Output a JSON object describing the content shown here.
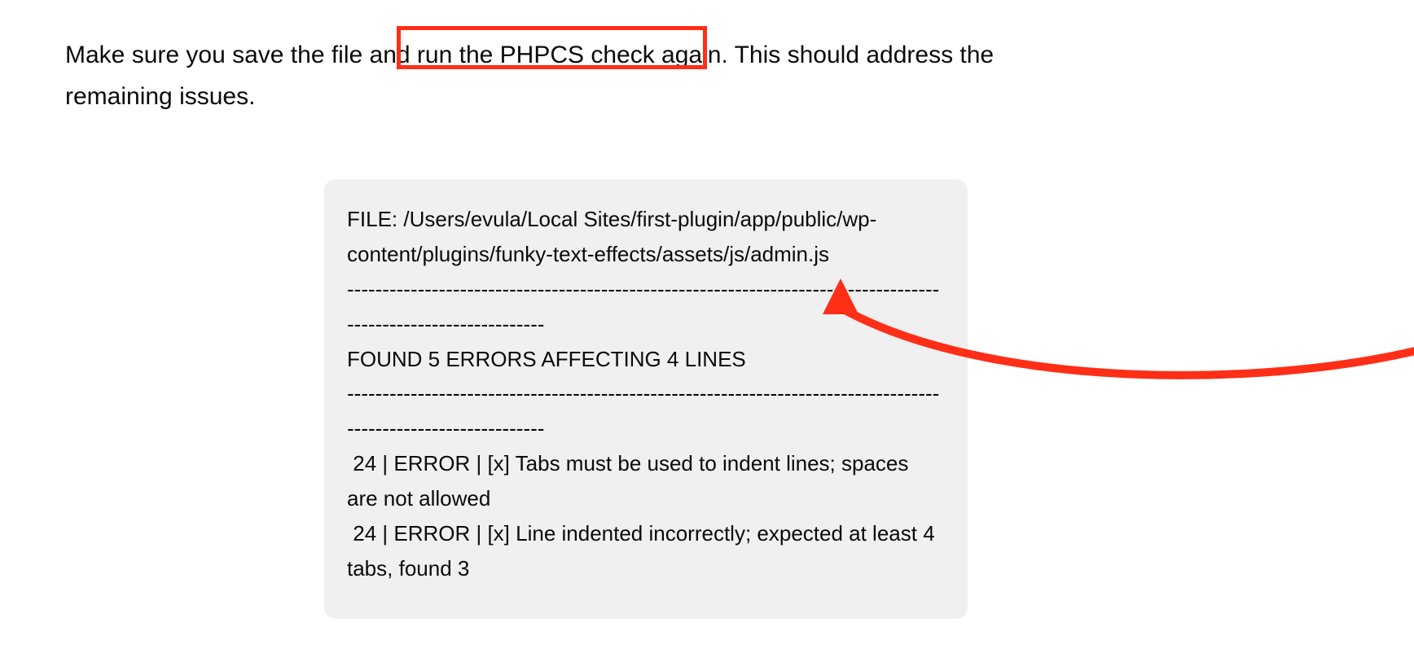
{
  "instruction": {
    "text_before": "Make sure you save the file and ",
    "highlighted": "run the PHPCS check again.",
    "text_after": " This should address the remaining issues."
  },
  "code_output": {
    "file_label": "FILE: /Users/evula/Local Sites/first-plugin/app/public/wp-content/plugins/funky-text-effects/assets/js/admin.js",
    "divider1": "----------------------------------------------------------------------------------------------------------------",
    "summary": "FOUND 5 ERRORS AFFECTING 4 LINES",
    "divider2": "----------------------------------------------------------------------------------------------------------------",
    "errors": [
      {
        "line": " 24 | ERROR | [x] Tabs must be used to indent lines; spaces are not allowed"
      },
      {
        "line": " 24 | ERROR | [x] Line indented incorrectly; expected at least 4 tabs, found 3"
      }
    ]
  },
  "annotation": {
    "style": "red-box-and-arrow",
    "color": "#ff2e17"
  }
}
